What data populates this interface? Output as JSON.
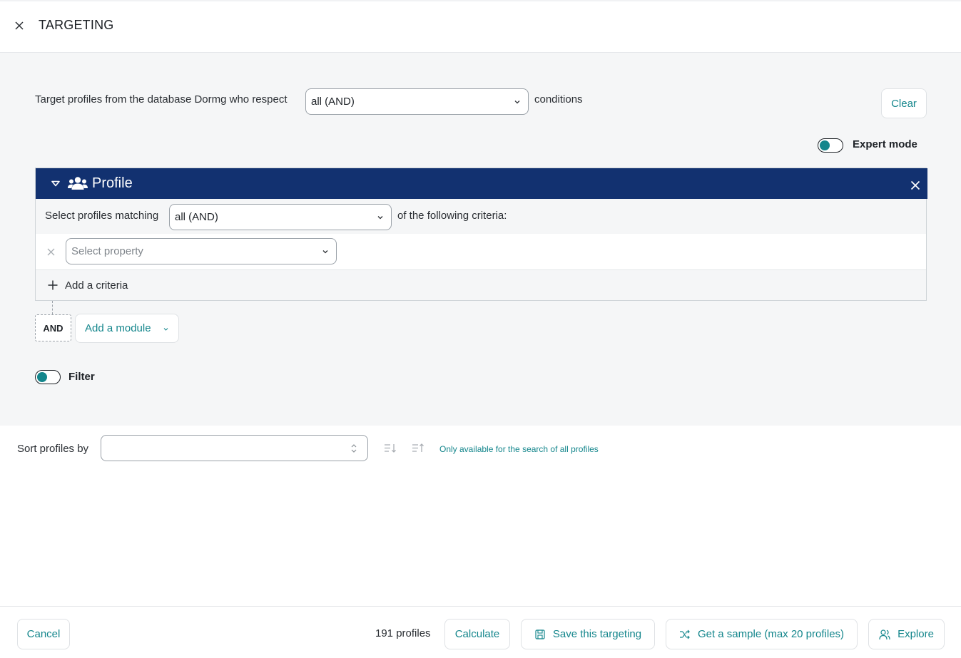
{
  "header": {
    "title": "TARGETING"
  },
  "intro": {
    "text": "Target profiles from the database Dormg who respect",
    "logic_value": "all (AND)",
    "suffix": "conditions",
    "clear_label": "Clear"
  },
  "expert_mode": {
    "label": "Expert mode",
    "enabled": true
  },
  "module": {
    "title": "Profile",
    "match_text": "Select profiles matching",
    "match_value": "all (AND)",
    "criteria_text": "of the following criteria:",
    "property_placeholder": "Select property",
    "add_criteria_label": "Add a criteria"
  },
  "connector": {
    "and_label": "AND",
    "add_module_label": "Add a module"
  },
  "filter": {
    "label": "Filter",
    "enabled": true
  },
  "sort": {
    "label": "Sort profiles by",
    "value": "",
    "note": "Only available for the search of all profiles"
  },
  "footer": {
    "cancel_label": "Cancel",
    "profiles_count": "191 profiles",
    "calculate_label": "Calculate",
    "save_label": "Save this targeting",
    "sample_label": "Get a sample (max 20 profiles)",
    "explore_label": "Explore"
  },
  "colors": {
    "accent": "#14868c",
    "module_header": "#123170",
    "panel_bg": "#f5f6f7"
  },
  "icons": [
    "close-icon",
    "chevron-down-icon",
    "caret-down-icon",
    "users-icon",
    "plus-icon",
    "sort-desc-icon",
    "sort-asc-icon",
    "save-icon",
    "shuffle-icon",
    "explore-users-icon"
  ]
}
